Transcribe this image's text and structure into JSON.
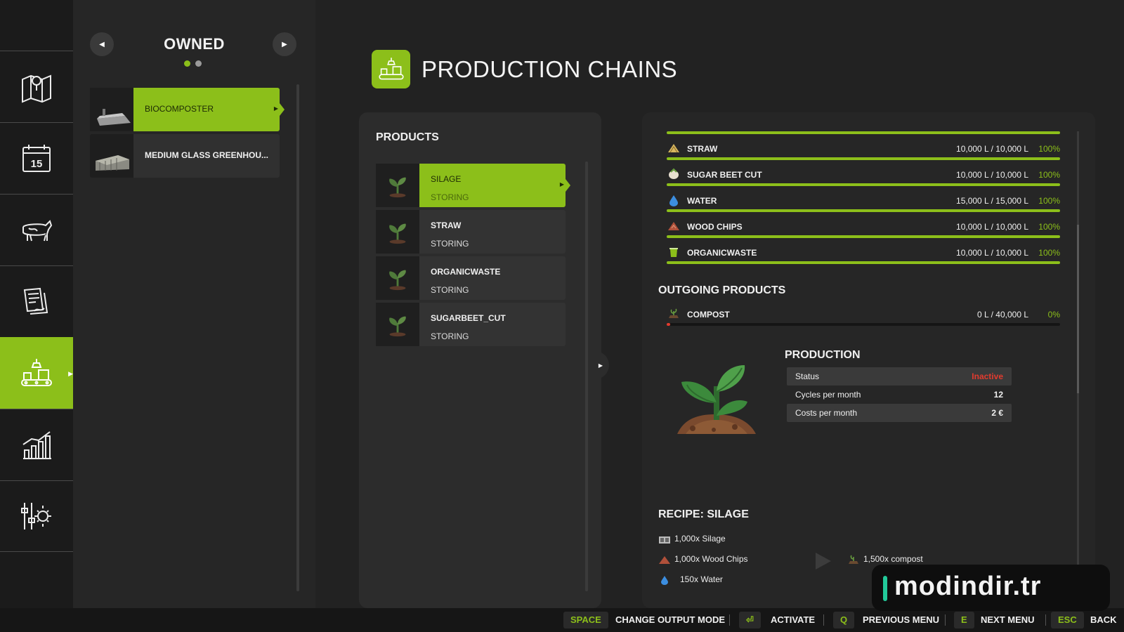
{
  "nav": {
    "items": [
      {
        "name": "map-icon"
      },
      {
        "name": "calendar-icon",
        "label": "15"
      },
      {
        "name": "animals-icon"
      },
      {
        "name": "contracts-icon"
      },
      {
        "name": "production-icon",
        "active": true
      },
      {
        "name": "statistics-icon"
      },
      {
        "name": "settings-icon"
      }
    ]
  },
  "owned": {
    "title": "OWNED",
    "page_count": 2,
    "current_page": 1,
    "items": [
      {
        "label": "BIOCOMPOSTER",
        "selected": true
      },
      {
        "label": "MEDIUM GLASS GREENHOU..."
      }
    ]
  },
  "header": {
    "title": "PRODUCTION CHAINS"
  },
  "products": {
    "title": "PRODUCTS",
    "items": [
      {
        "name": "SILAGE",
        "state": "STORING",
        "selected": true
      },
      {
        "name": "STRAW",
        "state": "STORING"
      },
      {
        "name": "ORGANICWASTE",
        "state": "STORING"
      },
      {
        "name": "SUGARBEET_CUT",
        "state": "STORING"
      }
    ]
  },
  "incoming": [
    {
      "name": "STRAW",
      "amount": "10,000 L / 10,000 L",
      "percent": "100%",
      "fill": 1.0,
      "icon": "straw-icon"
    },
    {
      "name": "SUGAR BEET CUT",
      "amount": "10,000 L / 10,000 L",
      "percent": "100%",
      "fill": 1.0,
      "icon": "sugar-beet-icon"
    },
    {
      "name": "WATER",
      "amount": "15,000 L / 15,000 L",
      "percent": "100%",
      "fill": 1.0,
      "icon": "water-drop-icon"
    },
    {
      "name": "WOOD CHIPS",
      "amount": "10,000 L / 10,000 L",
      "percent": "100%",
      "fill": 1.0,
      "icon": "wood-chips-icon"
    },
    {
      "name": "ORGANICWASTE",
      "amount": "10,000 L / 10,000 L",
      "percent": "100%",
      "fill": 1.0,
      "icon": "organic-waste-icon"
    }
  ],
  "outgoing": {
    "title": "OUTGOING PRODUCTS",
    "items": [
      {
        "name": "COMPOST",
        "amount": "0 L / 40,000 L",
        "percent": "0%",
        "fill": 0.0,
        "icon": "compost-icon"
      }
    ]
  },
  "production": {
    "title": "PRODUCTION",
    "rows": [
      {
        "label": "Status",
        "value": "Inactive"
      },
      {
        "label": "Cycles per month",
        "value": "12"
      },
      {
        "label": "Costs per month",
        "value": "2 €"
      }
    ]
  },
  "recipe": {
    "title": "RECIPE: SILAGE",
    "inputs": [
      "1,000x Silage",
      "1,000x Wood Chips",
      "150x Water"
    ],
    "output": "1,500x compost"
  },
  "footer": {
    "actions": [
      {
        "key": "SPACE",
        "label": "CHANGE OUTPUT MODE"
      },
      {
        "key": "⏎",
        "label": "ACTIVATE"
      },
      {
        "key": "Q",
        "label": "PREVIOUS MENU"
      },
      {
        "key": "E",
        "label": "NEXT MENU"
      },
      {
        "key": "ESC",
        "label": "BACK"
      }
    ]
  },
  "watermark": {
    "text": "modindir.tr"
  },
  "colors": {
    "accent": "#8cbf1a",
    "inactive": "#e23b2e",
    "background": "#222222"
  }
}
